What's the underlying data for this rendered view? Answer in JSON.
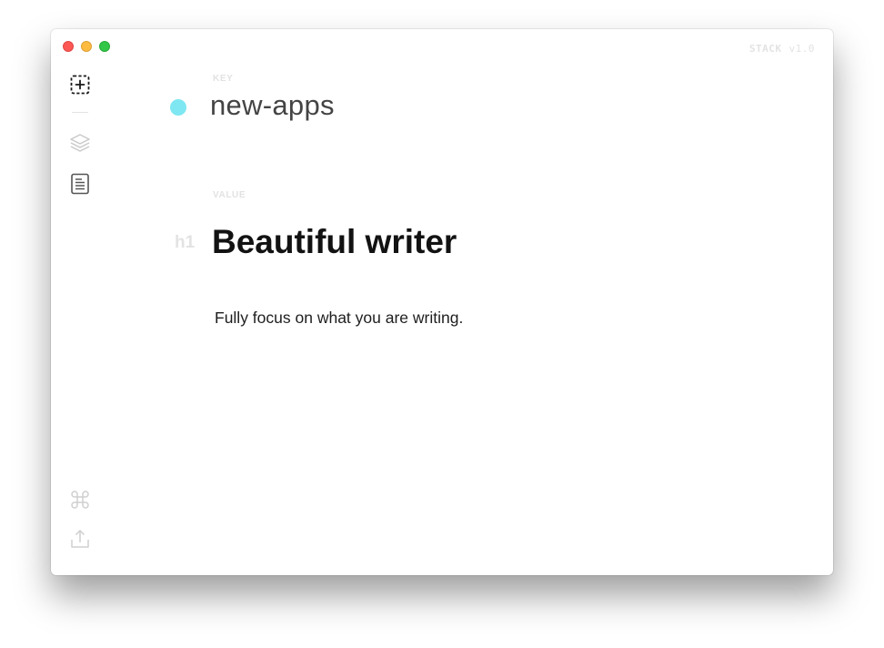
{
  "window": {
    "brand_name": "STACK",
    "brand_version": "v1.0"
  },
  "sidebar": {
    "items": [
      {
        "icon": "add-square-icon"
      },
      {
        "icon": "layers-icon"
      },
      {
        "icon": "document-icon"
      },
      {
        "icon": "command-icon"
      },
      {
        "icon": "upload-icon"
      }
    ]
  },
  "editor": {
    "key_label": "KEY",
    "key_value": "new-apps",
    "key_color": "#7ee7f2",
    "value_label": "VALUE",
    "heading_marker": "h1",
    "heading_text": "Beautiful writer",
    "paragraph_text": "Fully focus on what you are writing."
  }
}
